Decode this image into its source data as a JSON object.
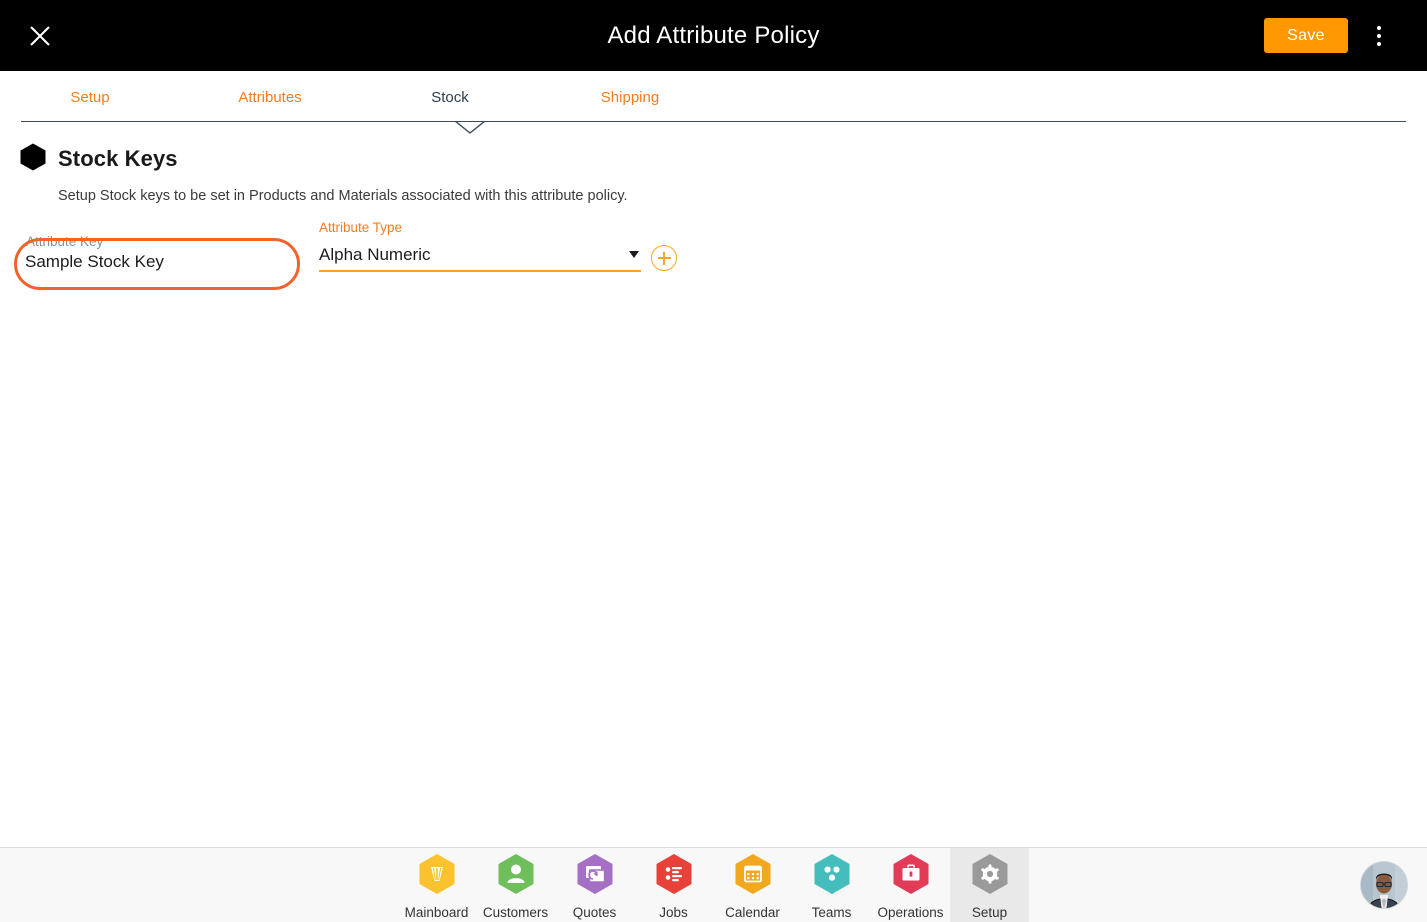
{
  "header": {
    "title": "Add Attribute Policy",
    "close_icon": "close-icon",
    "save_label": "Save",
    "overflow_icon": "kebab-menu-icon",
    "accent_color": "#FF9800",
    "background_color": "#000000"
  },
  "tabs": {
    "active": "Stock",
    "items": [
      {
        "label": "Setup"
      },
      {
        "label": "Attributes"
      },
      {
        "label": "Stock"
      },
      {
        "label": "Shipping"
      }
    ],
    "inactive_color": "#F57C20",
    "active_color": "#2C3E50"
  },
  "section": {
    "bullet_icon": "hexagon-bullet-icon",
    "title": "Stock Keys",
    "description": "Setup Stock keys to be set in Products and Materials associated with this attribute policy."
  },
  "form": {
    "attribute_key": {
      "label": "Attribute Key",
      "value": "Sample Stock Key",
      "placeholder": "Attribute Key",
      "focused": true,
      "focus_ring_color": "#F4622B"
    },
    "attribute_type": {
      "label": "Attribute Type",
      "value": "Alpha Numeric",
      "caret_icon": "chevron-down-icon",
      "underline_color": "#F5A623",
      "options": [
        "Alpha Numeric"
      ]
    },
    "add_button": {
      "icon": "plus-circle-icon",
      "color": "#F5A623"
    }
  },
  "bottom_nav": {
    "active": "Setup",
    "items": [
      {
        "label": "Mainboard",
        "icon": "mainboard-icon",
        "color": "#F9C22E"
      },
      {
        "label": "Customers",
        "icon": "customers-icon",
        "color": "#6EBF5C"
      },
      {
        "label": "Quotes",
        "icon": "quotes-icon",
        "color": "#A46FC4"
      },
      {
        "label": "Jobs",
        "icon": "jobs-icon",
        "color": "#E8413A"
      },
      {
        "label": "Calendar",
        "icon": "calendar-icon",
        "color": "#F2A81D"
      },
      {
        "label": "Teams",
        "icon": "teams-icon",
        "color": "#46BDBD"
      },
      {
        "label": "Operations",
        "icon": "operations-icon",
        "color": "#E23B58"
      },
      {
        "label": "Setup",
        "icon": "setup-gear-icon",
        "color": "#9A9A9A"
      }
    ],
    "avatar": {
      "icon": "user-avatar"
    }
  }
}
